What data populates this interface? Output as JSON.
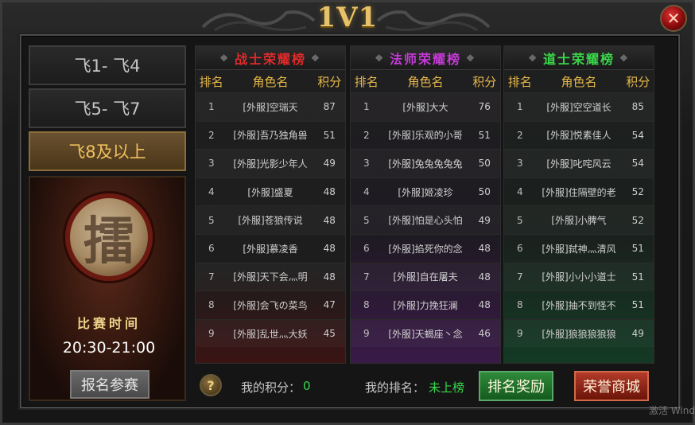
{
  "title": "1V1",
  "close_icon": "✕",
  "left_panel": {
    "tiers": [
      {
        "label": "飞1- 飞4",
        "active": false
      },
      {
        "label": "飞5- 飞7",
        "active": false
      },
      {
        "label": "飞8及以上",
        "active": true
      }
    ],
    "drum_char": "擂",
    "match_time_label": "比赛时间",
    "match_time": "20:30-21:00",
    "signup_label": "报名参赛"
  },
  "boards": [
    {
      "title": "战士荣耀榜",
      "title_color": "#e02a2a",
      "headers": {
        "rank": "排名",
        "name": "角色名",
        "score": "积分"
      },
      "rows": [
        {
          "rank": "1",
          "name": "[外服]空瑞天",
          "score": "87"
        },
        {
          "rank": "2",
          "name": "[外服]吾乃独角兽",
          "score": "51"
        },
        {
          "rank": "3",
          "name": "[外服]光影少年人",
          "score": "49"
        },
        {
          "rank": "4",
          "name": "[外服]盛夏",
          "score": "48"
        },
        {
          "rank": "5",
          "name": "[外服]苍狼传说",
          "score": "48"
        },
        {
          "rank": "6",
          "name": "[外服]慕凌香",
          "score": "48"
        },
        {
          "rank": "7",
          "name": "[外服]天下会灬明",
          "score": "48"
        },
        {
          "rank": "8",
          "name": "[外服]会飞の菜鸟",
          "score": "47"
        },
        {
          "rank": "9",
          "name": "[外服]乱世灬大妖",
          "score": "45"
        }
      ]
    },
    {
      "title": "法师荣耀榜",
      "title_color": "#c43ad6",
      "headers": {
        "rank": "排名",
        "name": "角色名",
        "score": "积分"
      },
      "rows": [
        {
          "rank": "1",
          "name": "[外服]大大",
          "score": "76"
        },
        {
          "rank": "2",
          "name": "[外服]乐观的小哥",
          "score": "51"
        },
        {
          "rank": "3",
          "name": "[外服]兔兔兔兔兔",
          "score": "50"
        },
        {
          "rank": "4",
          "name": "[外服]姬凌珍",
          "score": "50"
        },
        {
          "rank": "5",
          "name": "[外服]怕是心头怕",
          "score": "49"
        },
        {
          "rank": "6",
          "name": "[外服]掐死你的念",
          "score": "48"
        },
        {
          "rank": "7",
          "name": "[外服]自在屠夫",
          "score": "48"
        },
        {
          "rank": "8",
          "name": "[外服]力挽狂澜",
          "score": "48"
        },
        {
          "rank": "9",
          "name": "[外服]天蝎座丶念",
          "score": "46"
        }
      ]
    },
    {
      "title": "道士荣耀榜",
      "title_color": "#3ad64a",
      "headers": {
        "rank": "排名",
        "name": "角色名",
        "score": "积分"
      },
      "rows": [
        {
          "rank": "1",
          "name": "[外服]空空道长",
          "score": "85"
        },
        {
          "rank": "2",
          "name": "[外服]悦素佳人",
          "score": "54"
        },
        {
          "rank": "3",
          "name": "[外服]叱咤风云",
          "score": "54"
        },
        {
          "rank": "4",
          "name": "[外服]住隔壁的老",
          "score": "52"
        },
        {
          "rank": "5",
          "name": "[外服]小脾气",
          "score": "52"
        },
        {
          "rank": "6",
          "name": "[外服]弑神灬清风",
          "score": "51"
        },
        {
          "rank": "7",
          "name": "[外服]小小小道士",
          "score": "51"
        },
        {
          "rank": "8",
          "name": "[外服]抽不到怪不",
          "score": "51"
        },
        {
          "rank": "9",
          "name": "[外服]狼狼狼狼狼",
          "score": "49"
        }
      ]
    }
  ],
  "bottom": {
    "help_icon": "?",
    "my_score_label": "我的积分：",
    "my_score": "0",
    "my_rank_label": "我的排名：",
    "my_rank": "未上榜",
    "rank_reward_label": "排名奖励",
    "honor_shop_label": "荣誉商城"
  },
  "watermark": "激活 Wind"
}
